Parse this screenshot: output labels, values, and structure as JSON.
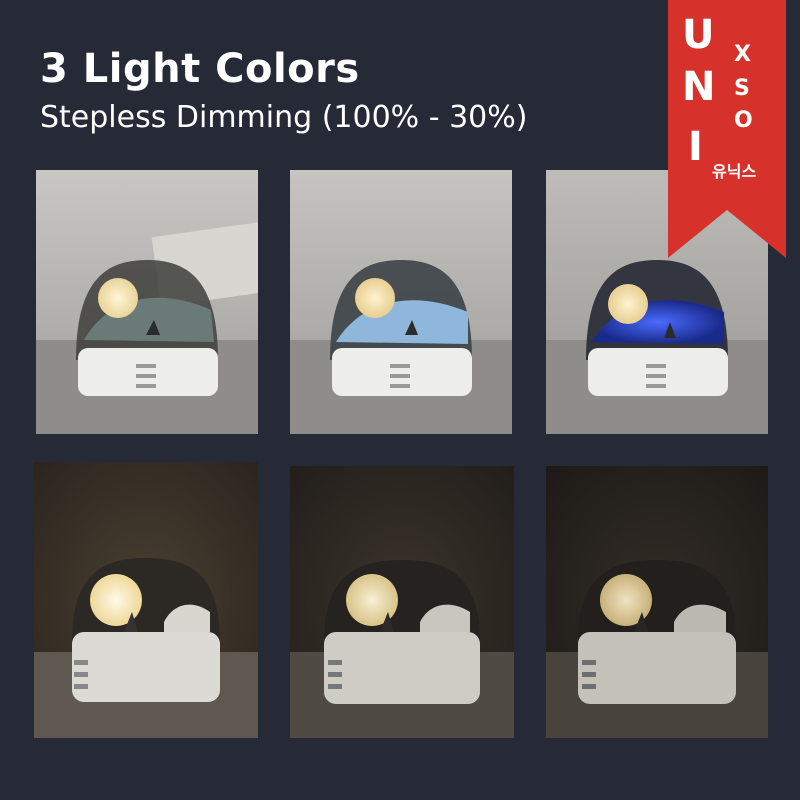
{
  "headline": "3 Light Colors",
  "subline": "Stepless Dimming (100% - 30%)",
  "brand": {
    "letters_large": [
      "U",
      "N",
      "I"
    ],
    "letters_small": [
      "X",
      "S",
      "O"
    ],
    "hangul": "유닉스",
    "color": "#d6322b"
  },
  "photos": {
    "top_row": [
      {
        "light_color": "warm white",
        "ring_color": "#f3e7c1"
      },
      {
        "light_color": "cool blue",
        "ring_color": "#7fb3e6"
      },
      {
        "light_color": "deep blue",
        "ring_color": "#3a5bff"
      }
    ],
    "bottom_row": [
      {
        "brightness": "100%"
      },
      {
        "brightness": "mid"
      },
      {
        "brightness": "30%"
      }
    ]
  }
}
